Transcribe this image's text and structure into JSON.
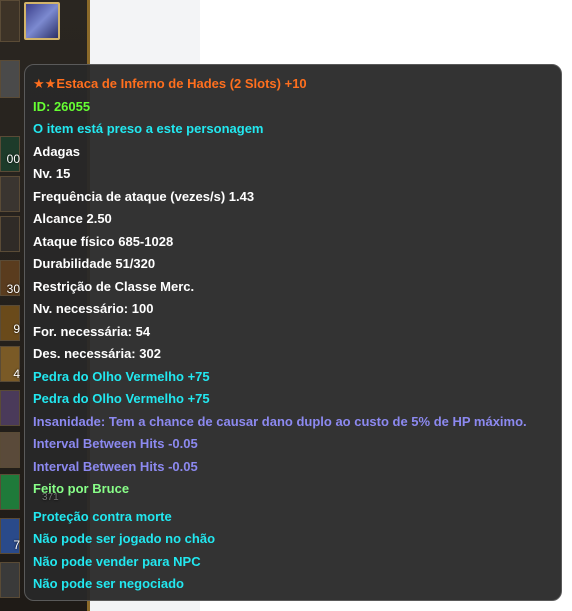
{
  "inventory": {
    "counts": [
      "00",
      "30",
      "9",
      "4",
      "371",
      "7"
    ]
  },
  "tooltip": {
    "title_stars": "★★",
    "title": "Estaca de Inferno de Hades (2 Slots) +10",
    "id_line": "ID: 26055",
    "bound": "O item está preso a este personagem",
    "type": "Adagas",
    "level": "Nv. 15",
    "attack_freq": "Frequência de ataque (vezes/s) 1.43",
    "range": "Alcance 2.50",
    "phys_attack": "Ataque físico 685-1028",
    "durability": "Durabilidade 51/320",
    "class_restriction": "Restrição de Classe Merc.",
    "req_level": "Nv. necessário: 100",
    "req_str": "For. necessária: 54",
    "req_dex": "Des. necessária: 302",
    "gem1": "Pedra do Olho Vermelho +75",
    "gem2": "Pedra do Olho Vermelho +75",
    "insanity": "Insanidade: Tem a chance de causar dano duplo ao custo de 5% de HP máximo.",
    "interval1": "Interval Between Hits -0.05",
    "interval2": "Interval Between Hits -0.05",
    "crafted_by": "Feito por Bruce",
    "death_protection": "Proteção contra morte",
    "no_drop": "Não pode ser jogado no chão",
    "no_npc_sell": "Não pode vender para NPC",
    "no_trade": "Não pode ser negociado"
  },
  "colors": {
    "title": "#ff6f1e",
    "id": "#66ff33",
    "cyan": "#22e8f0",
    "white": "#ffffff",
    "purple": "#8c89f0",
    "crafted": "#88ff88",
    "tooltip_bg": "#282828"
  }
}
